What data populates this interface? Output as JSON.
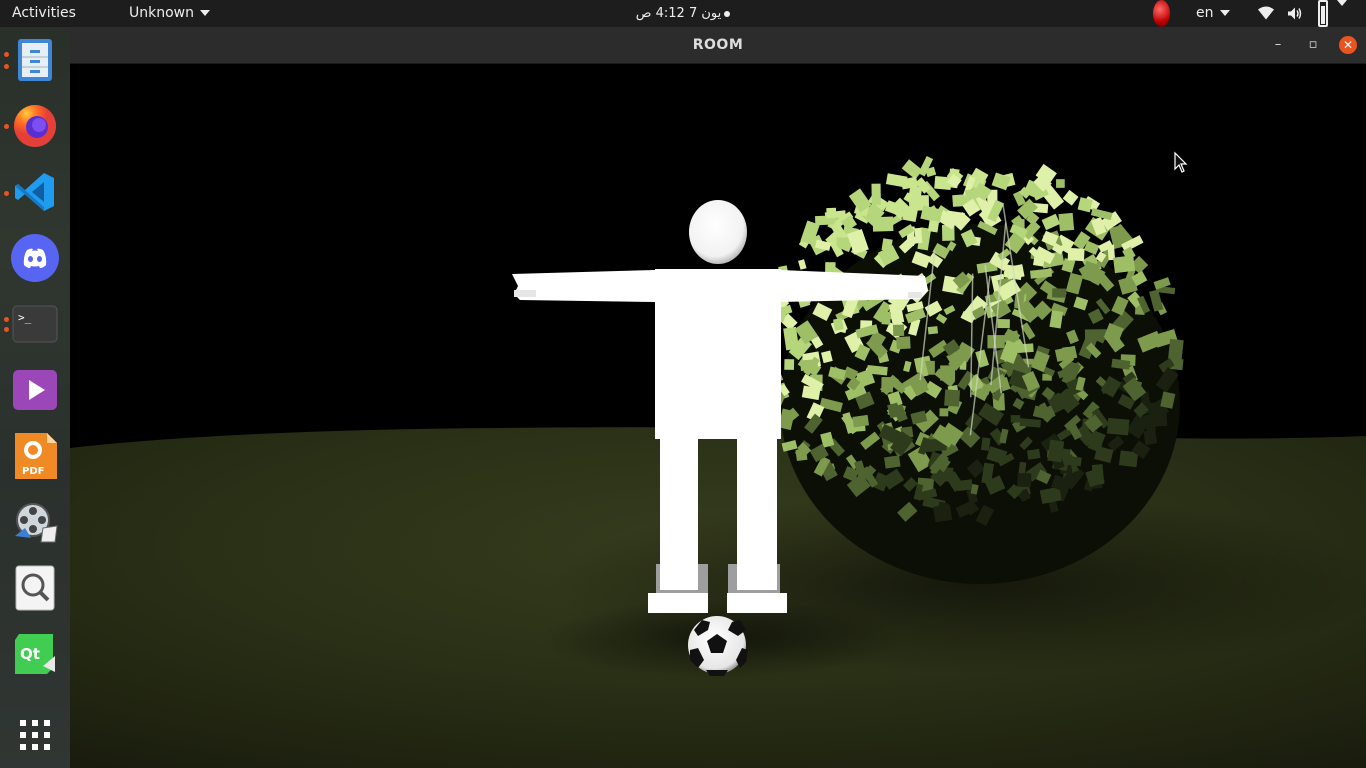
{
  "topbar": {
    "activities": "Activities",
    "app_menu": "Unknown",
    "clock": "يون 7  4:12 ص",
    "language": "en"
  },
  "dock": {
    "items": [
      {
        "name": "files-icon",
        "running": true
      },
      {
        "name": "firefox-icon",
        "running": true
      },
      {
        "name": "vscode-icon",
        "running": true
      },
      {
        "name": "discord-icon",
        "running": false
      },
      {
        "name": "terminal-icon",
        "running": true
      },
      {
        "name": "video-player-icon",
        "running": false
      },
      {
        "name": "pdf-reader-icon",
        "running": false
      },
      {
        "name": "media-converter-icon",
        "running": false
      },
      {
        "name": "image-viewer-icon",
        "running": false
      },
      {
        "name": "qt-creator-icon",
        "running": false
      }
    ],
    "app_grid_icon": "show-applications-icon"
  },
  "window": {
    "title": "ROOM",
    "minimize": "–",
    "maximize": "▫",
    "close": "✕"
  },
  "scene": {
    "objects": [
      "white-mannequin",
      "soccer-ball",
      "leafy-bush",
      "grass-ground",
      "night-sky"
    ],
    "colors": {
      "sky": "#000000",
      "grass": "#2c3216",
      "figure": "#ffffff",
      "leaves": "#c9e58e"
    }
  }
}
